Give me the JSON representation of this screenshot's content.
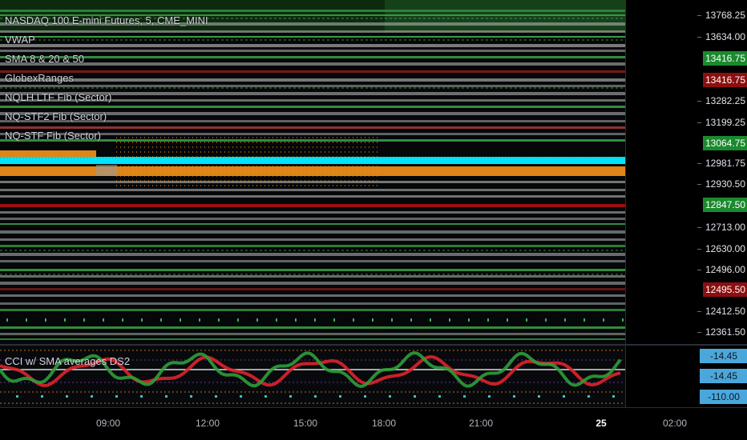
{
  "legend": {
    "symbol": "NASDAQ 100 E-mini Futures, 5, CME_MINI",
    "indicators": [
      "VWAP",
      "SMA 8 & 20 & 50",
      "GlobexRanges",
      "NQLH LTF Fib (Sector)",
      "NQ-STF2 Fib (Sector)",
      "NQ-STF Fib (Sector)"
    ]
  },
  "price_axis": {
    "labels": [
      {
        "text": "13768.25",
        "style": "plain"
      },
      {
        "text": "13634.00",
        "style": "plain"
      },
      {
        "text": "13416.75",
        "style": "green"
      },
      {
        "text": "13416.75",
        "style": "red"
      },
      {
        "text": "13282.25",
        "style": "plain"
      },
      {
        "text": "13199.25",
        "style": "plain"
      },
      {
        "text": "13064.75",
        "style": "green"
      },
      {
        "text": "12981.75",
        "style": "plain"
      },
      {
        "text": "12930.50",
        "style": "plain"
      },
      {
        "text": "12847.50",
        "style": "green"
      },
      {
        "text": "12713.00",
        "style": "plain"
      },
      {
        "text": "12630.00",
        "style": "plain"
      },
      {
        "text": "12496.00",
        "style": "plain"
      },
      {
        "text": "12495.50",
        "style": "red"
      },
      {
        "text": "12412.50",
        "style": "plain"
      },
      {
        "text": "12361.50",
        "style": "plain"
      }
    ]
  },
  "sub_pane": {
    "title": "CCI w/ SMA averages DS2",
    "axis_labels": [
      "-14.45",
      "-14.45",
      "-110.00"
    ]
  },
  "time_axis": {
    "labels": [
      "09:00",
      "12:00",
      "15:00",
      "18:00",
      "21:00",
      "25",
      "02:00"
    ]
  },
  "colors": {
    "background": "#050708",
    "axis_background": "#000000",
    "green_box": "#1b8a2e",
    "red_box": "#8c0f0f",
    "cyan_line": "#00e5ff",
    "orange_line": "#f7931a",
    "cci_green": "#2e9e3a",
    "cci_red": "#e0242b",
    "sub_label_blue": "#4aa7dc"
  }
}
